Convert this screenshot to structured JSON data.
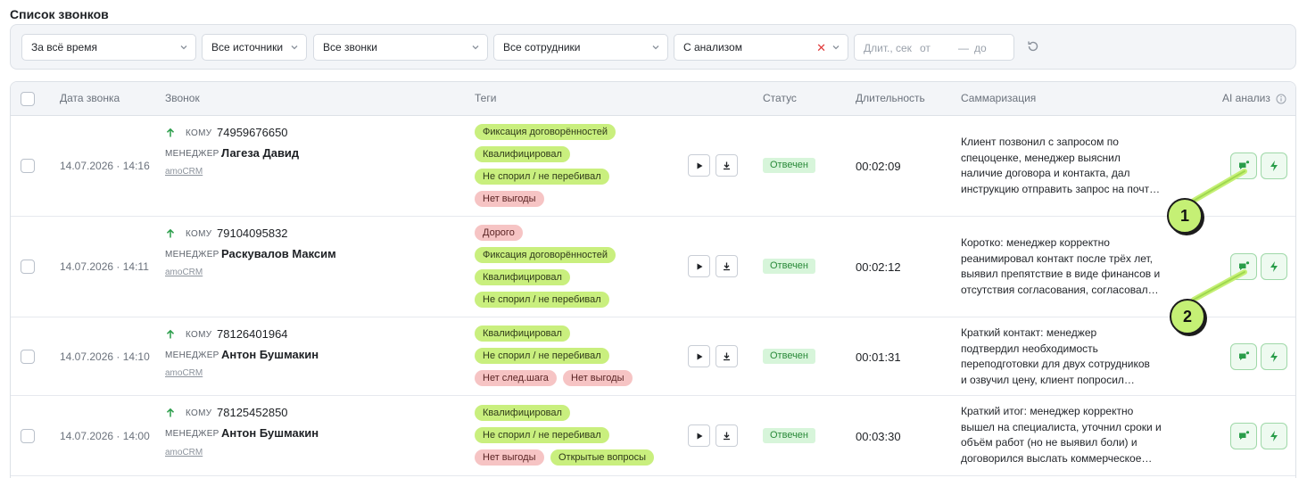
{
  "page": {
    "title": "Список звонков"
  },
  "filters": {
    "period": "За всё время",
    "sources": "Все источники",
    "calls": "Все звонки",
    "employees": "Все сотрудники",
    "analysis": "С анализом",
    "duration_label": "Длит., сек",
    "duration_from": "от",
    "duration_dash": "—",
    "duration_to": "до"
  },
  "table": {
    "headers": {
      "date": "Дата звонка",
      "call": "Звонок",
      "tags": "Теги",
      "status": "Статус",
      "duration": "Длительность",
      "summary": "Саммаризация",
      "ai": "AI анализ"
    },
    "rows": [
      {
        "date": "14.07.2026 · 14:16",
        "to_label": "КОМУ",
        "phone": "74959676650",
        "manager_label": "МЕНЕДЖЕР",
        "manager": "Лагеза Давид",
        "source": "amoCRM",
        "tags": [
          {
            "text": "Фиксация договорённостей",
            "color": "green"
          },
          {
            "text": "Квалифицировал",
            "color": "green"
          },
          {
            "text": "Не спорил / не перебивал",
            "color": "green"
          },
          {
            "text": "Нет выгоды",
            "color": "red"
          }
        ],
        "status": "Отвечен",
        "duration": "00:02:09",
        "summary": [
          "Клиент позвонил с запросом по",
          "спецоценке, менеджер выяснил",
          "наличие договора и контакта, дал",
          "инструкцию отправить запрос на почт…"
        ]
      },
      {
        "date": "14.07.2026 · 14:11",
        "to_label": "КОМУ",
        "phone": "79104095832",
        "manager_label": "МЕНЕДЖЕР",
        "manager": "Раскувалов Максим",
        "source": "amoCRM",
        "tags": [
          {
            "text": "Дорого",
            "color": "red"
          },
          {
            "text": "Фиксация договорённостей",
            "color": "green"
          },
          {
            "text": "Квалифицировал",
            "color": "green"
          },
          {
            "text": "Не спорил / не перебивал",
            "color": "green"
          }
        ],
        "status": "Отвечен",
        "duration": "00:02:12",
        "summary": [
          "Коротко: менеджер корректно",
          "реанимировал контакт после трёх лет,",
          "выявил препятствие в виде финансов и",
          "отсутствия согласования, согласовал…"
        ]
      },
      {
        "date": "14.07.2026 · 14:10",
        "to_label": "КОМУ",
        "phone": "78126401964",
        "manager_label": "МЕНЕДЖЕР",
        "manager": "Антон Бушмакин",
        "source": "amoCRM",
        "tags": [
          {
            "text": "Квалифицировал",
            "color": "green"
          },
          {
            "text": "Не спорил / не перебивал",
            "color": "green"
          },
          {
            "text": "Нет след.шага",
            "color": "red"
          },
          {
            "text": "Нет выгоды",
            "color": "red"
          }
        ],
        "status": "Отвечен",
        "duration": "00:01:31",
        "summary": [
          "Краткий контакт: менеджер",
          "подтвердил необходимость",
          "переподготовки для двух сотрудников",
          "и озвучил цену, клиент попросил…"
        ]
      },
      {
        "date": "14.07.2026 · 14:00",
        "to_label": "КОМУ",
        "phone": "78125452850",
        "manager_label": "МЕНЕДЖЕР",
        "manager": "Антон Бушмакин",
        "source": "amoCRM",
        "tags": [
          {
            "text": "Квалифицировал",
            "color": "green"
          },
          {
            "text": "Не спорил / не перебивал",
            "color": "green"
          },
          {
            "text": "Нет выгоды",
            "color": "red"
          },
          {
            "text": "Открытые вопросы",
            "color": "green"
          }
        ],
        "status": "Отвечен",
        "duration": "00:03:30",
        "summary": [
          "Краткий итог: менеджер корректно",
          "вышел на специалиста, уточнил сроки и",
          "объём работ (но не выявил боли) и",
          "договорился выслать коммерческое…"
        ]
      }
    ]
  },
  "callouts": [
    "1",
    "2"
  ],
  "icons": {
    "arrow_up": "arrow-up-icon",
    "play": "play-icon",
    "download": "download-icon",
    "chat": "chat-icon",
    "bolt": "bolt-icon",
    "info": "info-icon",
    "refresh": "refresh-icon",
    "chevron": "chevron-down-icon",
    "clear": "clear-icon"
  },
  "colors": {
    "accent_green": "#2a9d4a",
    "tag_green": "#c9ef7e",
    "tag_red": "#f6c4c4",
    "status_bg": "#d7f5da",
    "callout": "#c5f075"
  }
}
